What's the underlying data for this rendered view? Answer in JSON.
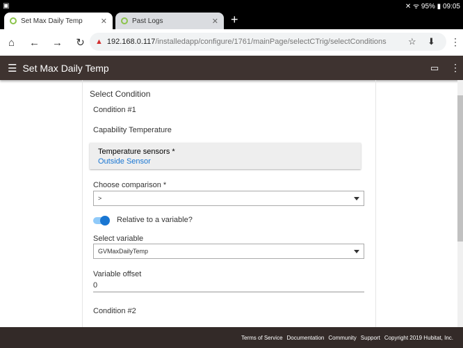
{
  "status_bar": {
    "battery": "95%",
    "time": "09:05"
  },
  "browser": {
    "tabs": [
      {
        "label": "Set Max Daily Temp"
      },
      {
        "label": "Past Logs"
      }
    ],
    "url_host": "192.168.0.117",
    "url_path": "/installedapp/configure/1761/mainPage/selectCTrig/selectConditions"
  },
  "app": {
    "title": "Set Max Daily Temp"
  },
  "form": {
    "section": "Select Condition",
    "condition1": "Condition #1",
    "capability": "Capability Temperature",
    "sensors_label": "Temperature sensors *",
    "sensors_value": "Outside Sensor",
    "comparison_label": "Choose comparison *",
    "comparison_value": ">",
    "relative_label": "Relative to a variable?",
    "relative_on": true,
    "variable_label": "Select variable",
    "variable_value": "GVMaxDailyTemp",
    "offset_label": "Variable offset",
    "offset_value": "0",
    "condition2": "Condition #2"
  },
  "footer": [
    "Terms of Service",
    "Documentation",
    "Community",
    "Support",
    "Copyright 2019 Hubitat, Inc."
  ]
}
